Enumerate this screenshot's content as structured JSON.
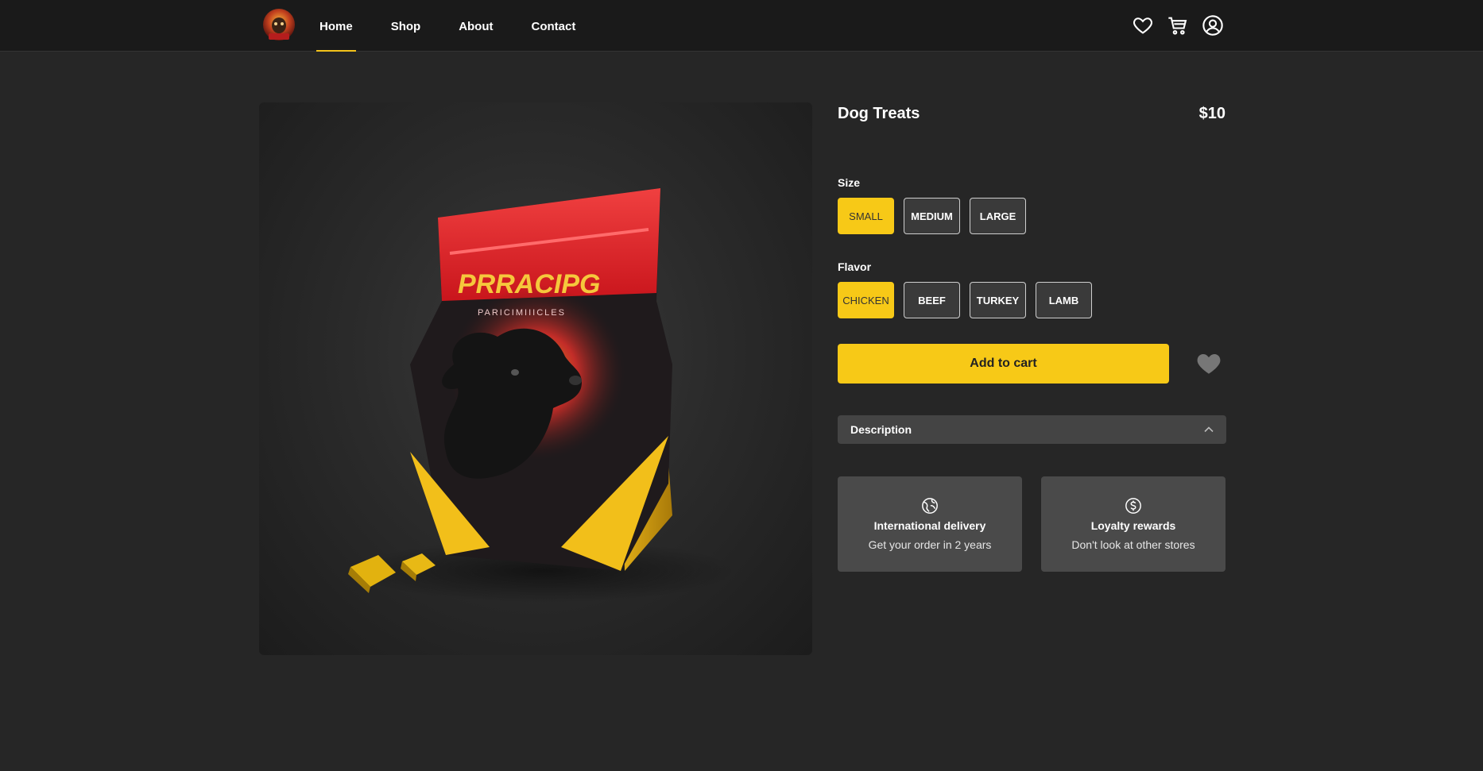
{
  "nav": {
    "logo_alt": "brand-logo",
    "items": [
      {
        "label": "Home",
        "active": true
      },
      {
        "label": "Shop",
        "active": false
      },
      {
        "label": "About",
        "active": false
      },
      {
        "label": "Contact",
        "active": false
      }
    ],
    "icons": [
      "heart-icon",
      "cart-icon",
      "user-icon"
    ]
  },
  "product": {
    "title": "Dog Treats",
    "price": "$10",
    "image_icon": "dog-treat-bag-image",
    "package_text": "PRRACIPG",
    "package_subtext": "PARICIMIIICLES"
  },
  "size": {
    "label": "Size",
    "options": [
      "SMALL",
      "MEDIUM",
      "LARGE"
    ],
    "selected": "SMALL"
  },
  "flavor": {
    "label": "Flavor",
    "options": [
      "CHICKEN",
      "BEEF",
      "TURKEY",
      "LAMB"
    ],
    "selected": "CHICKEN"
  },
  "actions": {
    "add_to_cart": "Add to cart"
  },
  "description": {
    "label": "Description"
  },
  "features": [
    {
      "icon": "globe-icon",
      "title": "International delivery",
      "text": "Get your order in 2 years"
    },
    {
      "icon": "dollar-icon",
      "title": "Loyalty rewards",
      "text": "Don't look at other stores"
    }
  ],
  "colors": {
    "accent": "#f7c917",
    "background": "#262626",
    "topbar": "#1a1a1a"
  }
}
